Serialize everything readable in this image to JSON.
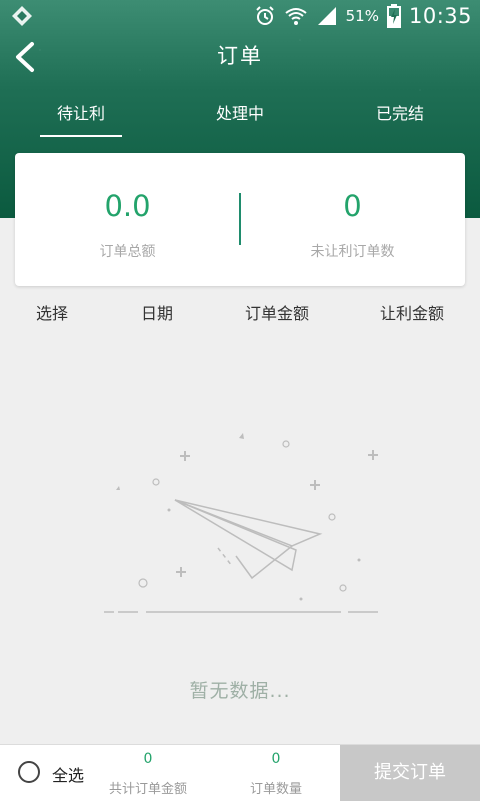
{
  "status_bar": {
    "battery_percent": "51%",
    "time": "10:35",
    "icons": [
      "app-logo-icon",
      "alarm-icon",
      "wifi-icon",
      "signal-icon",
      "battery-charging-icon"
    ]
  },
  "header": {
    "title": "订单",
    "back_icon": "chevron-left-icon"
  },
  "tabs": [
    {
      "label": "待让利",
      "active": true
    },
    {
      "label": "处理中",
      "active": false
    },
    {
      "label": "已完结",
      "active": false
    }
  ],
  "summary": {
    "total_amount_value": "0.0",
    "total_amount_label": "订单总额",
    "pending_count_value": "0",
    "pending_count_label": "未让利订单数"
  },
  "table_headers": [
    "选择",
    "日期",
    "订单金额",
    "让利金额"
  ],
  "empty_state": {
    "icon": "paper-plane-icon",
    "text": "暂无数据..."
  },
  "footer": {
    "select_all_label": "全选",
    "total_amount_value": "0",
    "total_amount_label": "共计订单金额",
    "order_count_value": "0",
    "order_count_label": "订单数量",
    "submit_label": "提交订单"
  },
  "colors": {
    "accent_green": "#23a36b",
    "header_gradient_top": "#3d8d73",
    "header_gradient_bottom": "#0b5a3f",
    "submit_disabled_bg": "#c8c8c8"
  }
}
